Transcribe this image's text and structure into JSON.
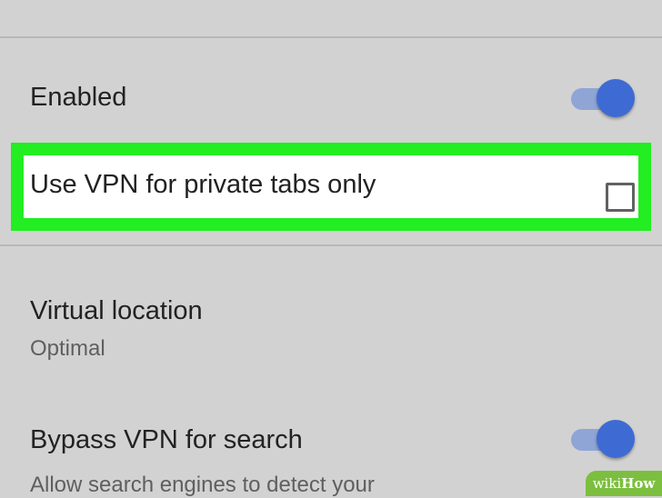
{
  "settings": {
    "enabled": {
      "label": "Enabled",
      "toggle_on": true
    },
    "private_tabs": {
      "label": "Use VPN for private tabs only",
      "checked": false
    },
    "virtual_location": {
      "label": "Virtual location",
      "value": "Optimal"
    },
    "bypass_search": {
      "label": "Bypass VPN for search",
      "description": "Allow search engines to detect your",
      "toggle_on": true
    }
  },
  "colors": {
    "toggle_thumb": "#3e6bd3",
    "toggle_track": "#8fa5d6",
    "highlight": "#22ee22",
    "background": "#d2d2d2"
  },
  "watermark": {
    "wiki": "wiki",
    "how": "How"
  }
}
